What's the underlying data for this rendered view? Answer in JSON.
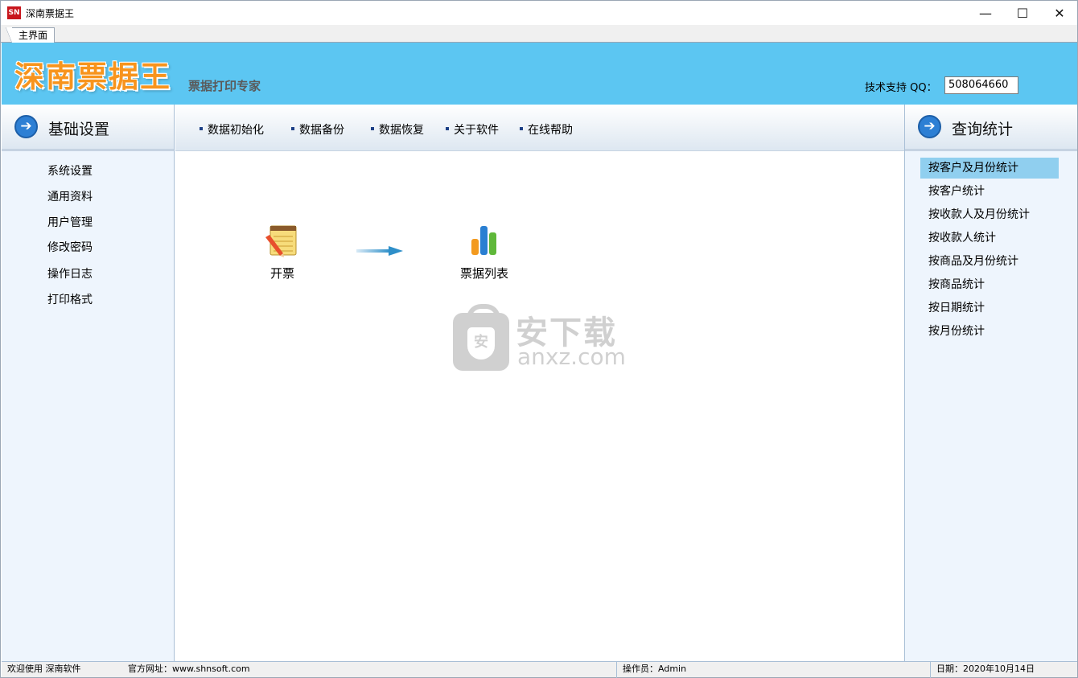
{
  "window": {
    "title": "深南票据王",
    "app_icon": "SN",
    "minimize": "—",
    "maximize": "☐",
    "close": "✕"
  },
  "tabs": [
    {
      "label": "主界面"
    }
  ],
  "header": {
    "logo": "深南票据王",
    "slogan": "票据打印专家",
    "qq_label": "技术支持 QQ：",
    "qq_value": "508064660"
  },
  "left_panel": {
    "title": "基础设置",
    "items": [
      "系统设置",
      "通用资料",
      "用户管理",
      "修改密码",
      "操作日志",
      "打印格式"
    ]
  },
  "toolbar": {
    "items": [
      "数据初始化",
      "数据备份",
      "数据恢复",
      "关于软件",
      "在线帮助"
    ]
  },
  "main": {
    "flow": [
      {
        "label": "开票",
        "icon": "notepad-pencil-icon"
      },
      {
        "label": "票据列表",
        "icon": "bar-chart-icon"
      }
    ],
    "watermark": {
      "cn": "安下载",
      "en": "anxz.com",
      "shield": "安"
    }
  },
  "right_panel": {
    "title": "查询统计",
    "items": [
      "按客户及月份统计",
      "按客户统计",
      "按收款人及月份统计",
      "按收款人统计",
      "按商品及月份统计",
      "按商品统计",
      "按日期统计",
      "按月份统计"
    ],
    "active_index": 0
  },
  "status": {
    "welcome": "欢迎使用 深南软件",
    "website": "官方网址：www.shnsoft.com",
    "operator": "操作员：Admin",
    "date": "日期：2020年10月14日"
  },
  "colors": {
    "banner": "#5cc6f2",
    "logo": "#f7941d",
    "active_item": "#90cfef",
    "panel_bg": "#eef5fd"
  }
}
